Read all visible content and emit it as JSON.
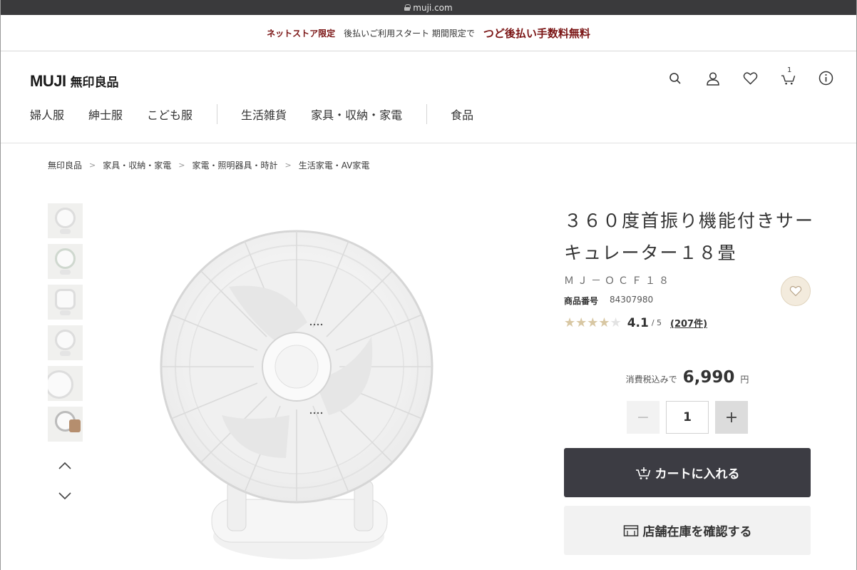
{
  "browser": {
    "url": "muji.com"
  },
  "promo": {
    "tag": "ネットストア限定",
    "sub": "後払いご利用スタート 期間限定で",
    "headline": "つど後払い手数料無料"
  },
  "header": {
    "logo_en": "MUJI",
    "logo_ja": "無印良品",
    "cart_count": "1",
    "nav": [
      "婦人服",
      "紳士服",
      "こども服",
      "生活雑貨",
      "家具・収納・家電",
      "食品"
    ]
  },
  "breadcrumb": [
    "無印良品",
    "家具・収納・家電",
    "家電・照明器具・時計",
    "生活家電・AV家電"
  ],
  "product": {
    "title_line1": "３６０度首振り機能付きサー",
    "title_line2": "キュレーター１８畳",
    "model": "ＭＪ－ＯＣＦ１８",
    "item_no_label": "商品番号",
    "item_no": "84307980",
    "rating": 4.1,
    "rating_text": "4.1",
    "rating_outof": "/ 5",
    "reviews": "(207件)",
    "price_label": "消費税込みで",
    "price": "6,990",
    "currency": "円",
    "quantity": "1",
    "minus": "−",
    "plus": "+",
    "cart_button": "カートに入れる",
    "store_button": "店舗在庫を確認する"
  },
  "colors": {
    "promo_red": "#7a1414",
    "button_dark": "#3c3c43",
    "star": "#d8c7a3",
    "fav_bg": "#f3ebdd"
  }
}
